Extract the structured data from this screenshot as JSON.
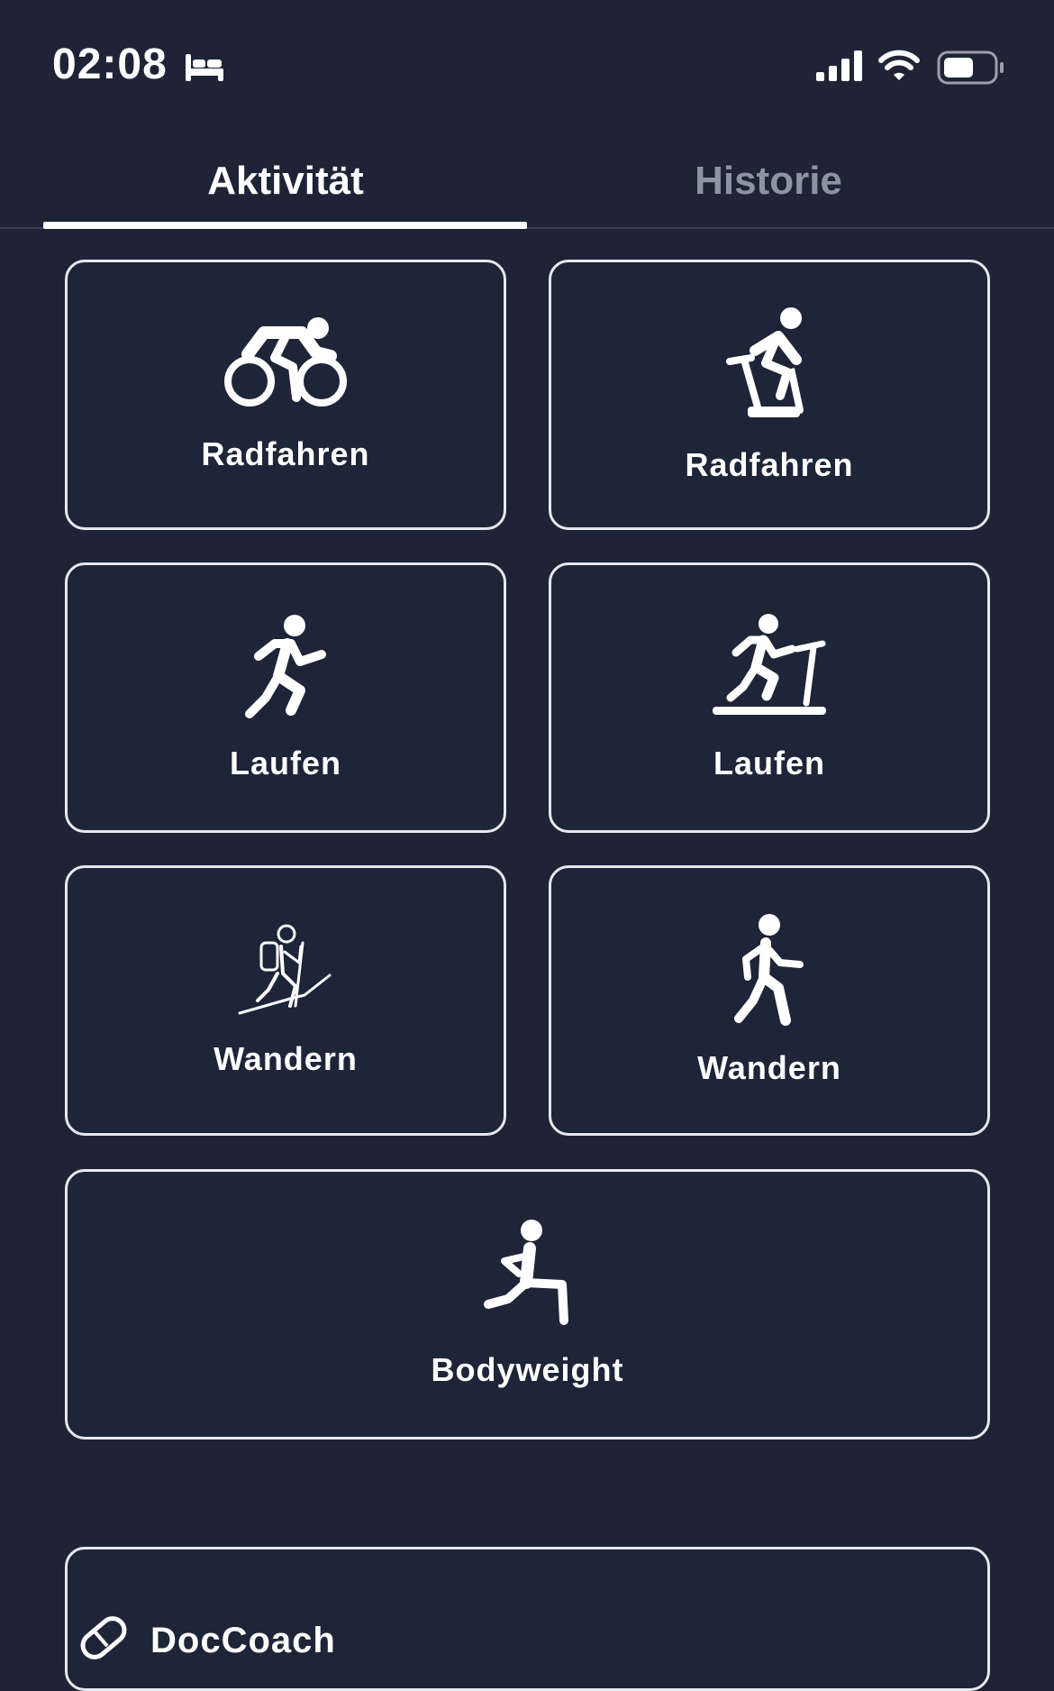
{
  "status_bar": {
    "time": "02:08",
    "icons": [
      "bed-icon",
      "cellular-signal-icon",
      "wifi-icon",
      "battery-icon"
    ]
  },
  "tabs": [
    {
      "label": "Aktivität",
      "active": true
    },
    {
      "label": "Historie",
      "active": false
    }
  ],
  "activities": [
    {
      "label": "Radfahren",
      "icon": "road-cycling-icon"
    },
    {
      "label": "Radfahren",
      "icon": "indoor-cycling-icon"
    },
    {
      "label": "Laufen",
      "icon": "running-icon"
    },
    {
      "label": "Laufen",
      "icon": "treadmill-icon"
    },
    {
      "label": "Wandern",
      "icon": "hiking-icon"
    },
    {
      "label": "Wandern",
      "icon": "walking-icon"
    },
    {
      "label": "Bodyweight",
      "icon": "lunge-icon"
    },
    {
      "label": "DocCoach",
      "icon": "bandage-icon"
    }
  ],
  "colors": {
    "background": "#1e2436",
    "card_border": "#e6e8ee",
    "tab_inactive": "#8c93a3",
    "text": "#ffffff"
  }
}
